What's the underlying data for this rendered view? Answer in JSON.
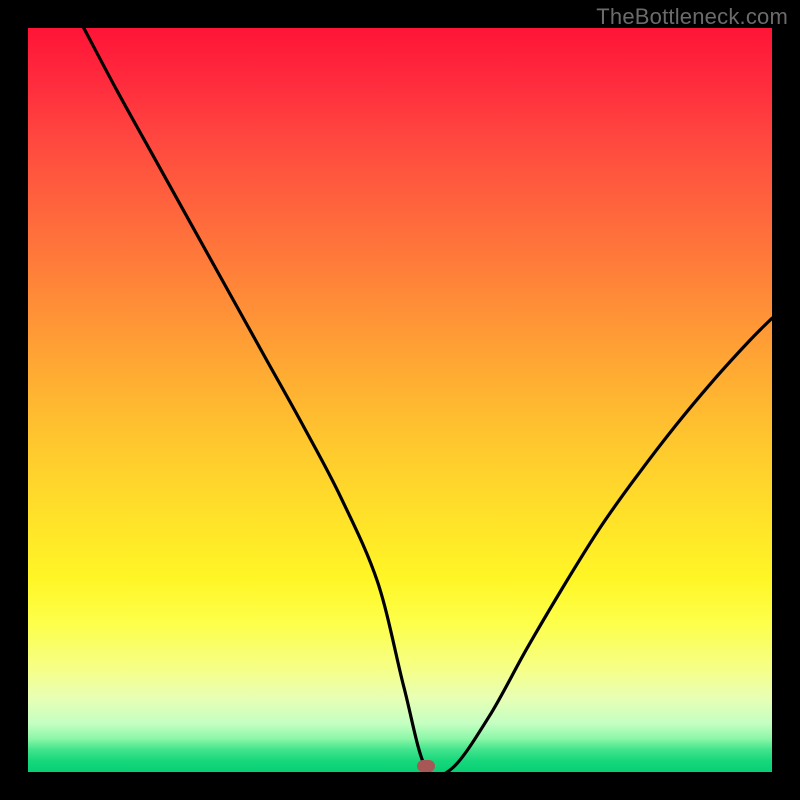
{
  "watermark": "TheBottleneck.com",
  "marker": {
    "x_frac": 0.535,
    "y_frac": 0.992,
    "color": "#c85a5a"
  },
  "chart_data": {
    "type": "line",
    "title": "",
    "xlabel": "",
    "ylabel": "",
    "xlim": [
      0,
      1
    ],
    "ylim": [
      0,
      1
    ],
    "background": "rainbow-vertical-gradient red→green",
    "series": [
      {
        "name": "bottleneck-curve",
        "x": [
          0.075,
          0.12,
          0.17,
          0.22,
          0.27,
          0.32,
          0.37,
          0.42,
          0.47,
          0.505,
          0.535,
          0.57,
          0.62,
          0.67,
          0.72,
          0.77,
          0.82,
          0.87,
          0.92,
          0.97,
          1.0
        ],
        "y": [
          1.0,
          0.915,
          0.825,
          0.735,
          0.645,
          0.555,
          0.465,
          0.37,
          0.255,
          0.115,
          0.005,
          0.005,
          0.075,
          0.165,
          0.25,
          0.33,
          0.4,
          0.465,
          0.525,
          0.58,
          0.61
        ]
      }
    ],
    "annotations": [
      {
        "type": "marker",
        "shape": "rounded-rect",
        "x": 0.535,
        "y": 0.008,
        "color": "#c85a5a"
      }
    ]
  }
}
